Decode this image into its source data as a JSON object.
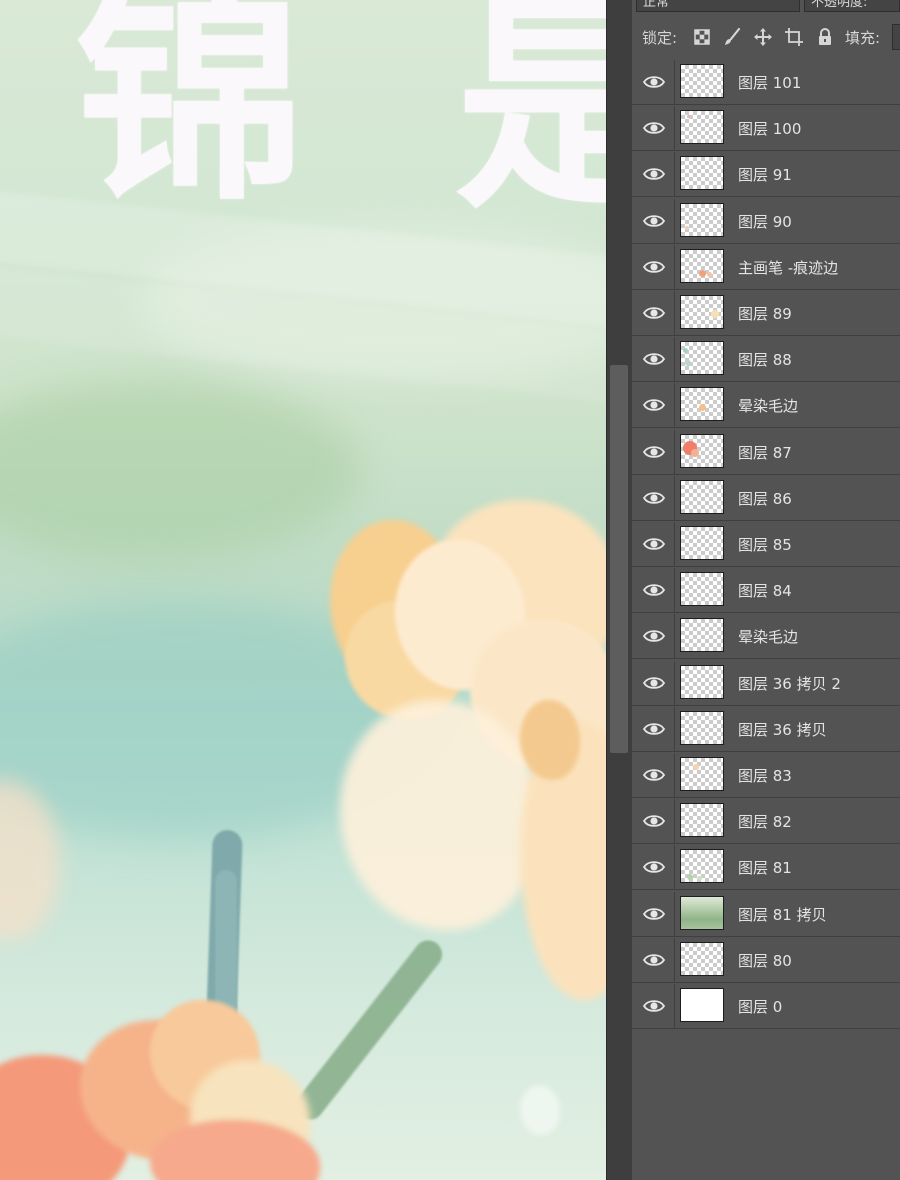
{
  "title_art": {
    "chars": [
      "锦",
      "是"
    ]
  },
  "panel": {
    "blend_mode": "正常",
    "opacity_label": "不透明度:",
    "lock_label": "锁定:",
    "fill_label": "填充:",
    "lock_icons": [
      "lock-transparent-pixels-icon",
      "brush-icon",
      "move-icon",
      "artboard-crop-icon",
      "padlock-icon"
    ]
  },
  "layers": [
    {
      "name": "图层 101",
      "visible": true,
      "thumb": "transparent",
      "dots": []
    },
    {
      "name": "图层 100",
      "visible": true,
      "thumb": "transparent",
      "dots": [
        {
          "c": "#f2b3a7",
          "x": 6,
          "y": 4,
          "s": 3
        }
      ]
    },
    {
      "name": "图层 91",
      "visible": true,
      "thumb": "transparent",
      "dots": []
    },
    {
      "name": "图层 90",
      "visible": true,
      "thumb": "transparent",
      "dots": [
        {
          "c": "#f5cdb2",
          "x": 4,
          "y": 22,
          "s": 4
        }
      ]
    },
    {
      "name": "主画笔 -痕迹边",
      "visible": true,
      "thumb": "transparent",
      "dots": [
        {
          "c": "#f0a27a",
          "x": 18,
          "y": 20,
          "s": 7
        },
        {
          "c": "#f7c2a5",
          "x": 26,
          "y": 22,
          "s": 5
        }
      ]
    },
    {
      "name": "图层 89",
      "visible": true,
      "thumb": "transparent",
      "dots": [
        {
          "c": "#f6e0b5",
          "x": 30,
          "y": 14,
          "s": 8
        }
      ]
    },
    {
      "name": "图层 88",
      "visible": true,
      "thumb": "transparent",
      "dots": [
        {
          "c": "#a9cfc2",
          "x": 2,
          "y": 6,
          "s": 5
        },
        {
          "c": "#b7d8cc",
          "x": 4,
          "y": 18,
          "s": 6
        }
      ]
    },
    {
      "name": "晕染毛边",
      "visible": true,
      "thumb": "transparent",
      "dots": [
        {
          "c": "#f4bf8a",
          "x": 18,
          "y": 16,
          "s": 7
        }
      ]
    },
    {
      "name": "图层 87",
      "visible": true,
      "thumb": "transparent",
      "dots": [
        {
          "c": "#ef7e6a",
          "x": 2,
          "y": 6,
          "s": 14
        },
        {
          "c": "#f4b08f",
          "x": 10,
          "y": 14,
          "s": 8
        }
      ]
    },
    {
      "name": "图层 86",
      "visible": true,
      "thumb": "transparent",
      "dots": []
    },
    {
      "name": "图层 85",
      "visible": true,
      "thumb": "transparent",
      "dots": []
    },
    {
      "name": "图层 84",
      "visible": true,
      "thumb": "transparent",
      "dots": []
    },
    {
      "name": "晕染毛边",
      "visible": true,
      "thumb": "transparent",
      "dots": []
    },
    {
      "name": "图层 36 拷贝 2",
      "visible": true,
      "thumb": "transparent",
      "dots": []
    },
    {
      "name": "图层 36 拷贝",
      "visible": true,
      "thumb": "transparent",
      "dots": []
    },
    {
      "name": "图层 83",
      "visible": true,
      "thumb": "transparent",
      "dots": [
        {
          "c": "#f6d2ae",
          "x": 12,
          "y": 6,
          "s": 6
        }
      ]
    },
    {
      "name": "图层 82",
      "visible": true,
      "thumb": "transparent",
      "dots": []
    },
    {
      "name": "图层 81",
      "visible": true,
      "thumb": "transparent",
      "dots": [
        {
          "c": "#b6d2a8",
          "x": 6,
          "y": 24,
          "s": 6
        },
        {
          "c": "#cde0c0",
          "x": 16,
          "y": 26,
          "s": 5
        }
      ]
    },
    {
      "name": "图层 81 拷贝",
      "visible": true,
      "thumb": "green",
      "dots": []
    },
    {
      "name": "图层 80",
      "visible": true,
      "thumb": "transparent",
      "dots": []
    },
    {
      "name": "图层 0",
      "visible": true,
      "thumb": "white",
      "dots": []
    }
  ]
}
